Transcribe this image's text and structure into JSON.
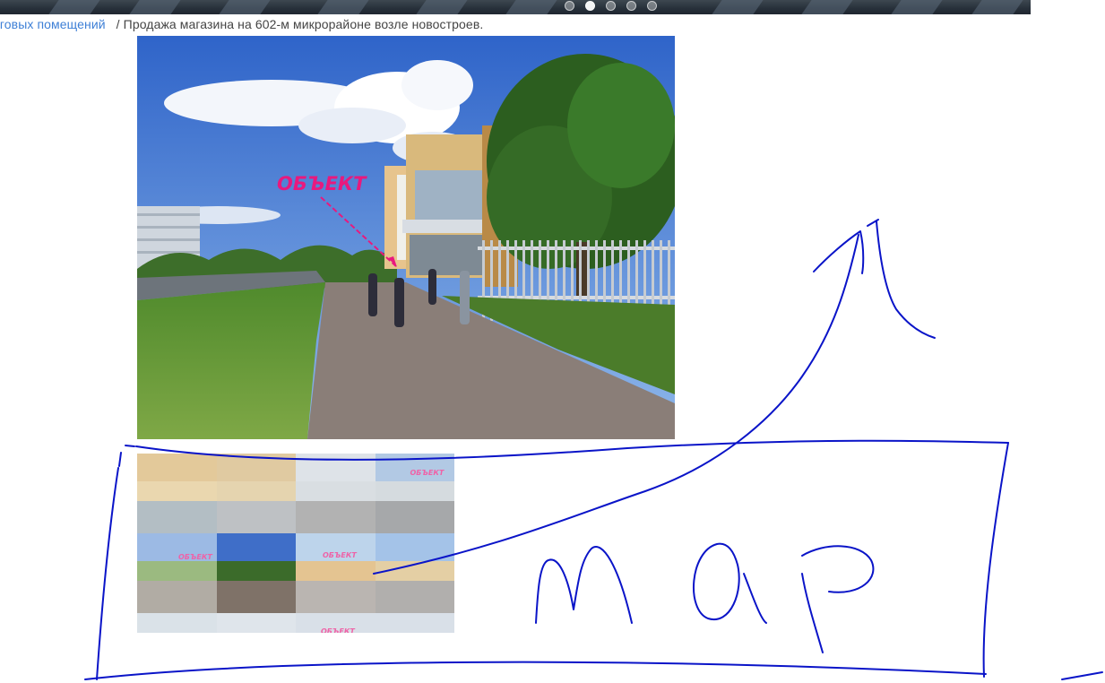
{
  "breadcrumb": {
    "link_text": "рговых помещений",
    "separator": "/",
    "current": "Продажа магазина на 602-м микрорайоне возле новостроев."
  },
  "main_photo": {
    "overlay_label": "ОБЪЕКТ"
  },
  "thumbnails": [
    {
      "label": ""
    },
    {
      "label": ""
    },
    {
      "label": ""
    },
    {
      "label": "ОБЪЕКТ"
    },
    {
      "label": "ОБЪЕКТ"
    },
    {
      "label": ""
    },
    {
      "label": "ОБЪЕКТ"
    },
    {
      "label": ""
    },
    {
      "label": ""
    },
    {
      "label": "ОБЪЕКТ"
    },
    {
      "label": "ОБЪЕКТ"
    },
    {
      "label": ""
    }
  ],
  "annotation": {
    "handwritten_text": "mOP",
    "ink_color": "#0a14c8"
  },
  "colors": {
    "link": "#3d7fd6",
    "overlay_label": "#e8197e"
  }
}
